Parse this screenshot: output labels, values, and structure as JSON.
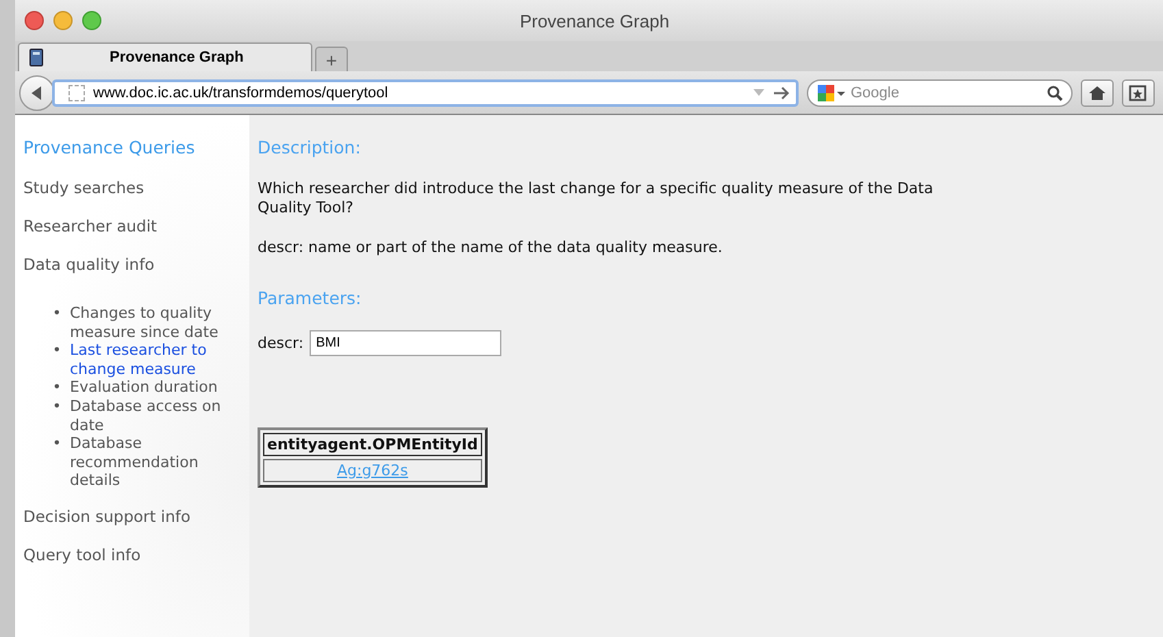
{
  "window": {
    "title": "Provenance Graph"
  },
  "tabs": [
    {
      "label": "Provenance Graph",
      "selected": true
    }
  ],
  "new_tab_button": "+",
  "address_bar": {
    "value": "www.doc.ic.ac.uk/transformdemos/querytool"
  },
  "search": {
    "placeholder": "Google"
  },
  "sidebar": {
    "title": "Provenance Queries",
    "items": [
      {
        "label": "Study searches"
      },
      {
        "label": "Researcher audit"
      },
      {
        "label": "Data quality info",
        "children": [
          {
            "marker": "•",
            "label": "Changes to quality measure since date",
            "selected": false
          },
          {
            "marker": "•",
            "label": "Last researcher to change measure",
            "selected": true
          },
          {
            "marker": "•",
            "label": "Evaluation duration",
            "selected": false
          },
          {
            "marker": "•",
            "label": "Database access on date",
            "selected": false
          },
          {
            "marker": "•",
            "label": "Database recommendation details",
            "selected": false
          }
        ]
      },
      {
        "label": "Decision support info"
      },
      {
        "label": "Query tool info"
      }
    ]
  },
  "description": {
    "heading": "Description:",
    "text": "Which researcher did introduce the last change for a specific quality measure of the Data Quality Tool?",
    "param_note": "descr: name or part of the name of the data quality measure."
  },
  "parameters": {
    "heading": "Parameters:",
    "label": "descr:",
    "value": "BMI"
  },
  "table": {
    "columns": [
      "entityagent.OPMEntityId"
    ],
    "rows": [
      [
        "Ag:g762s"
      ]
    ]
  }
}
